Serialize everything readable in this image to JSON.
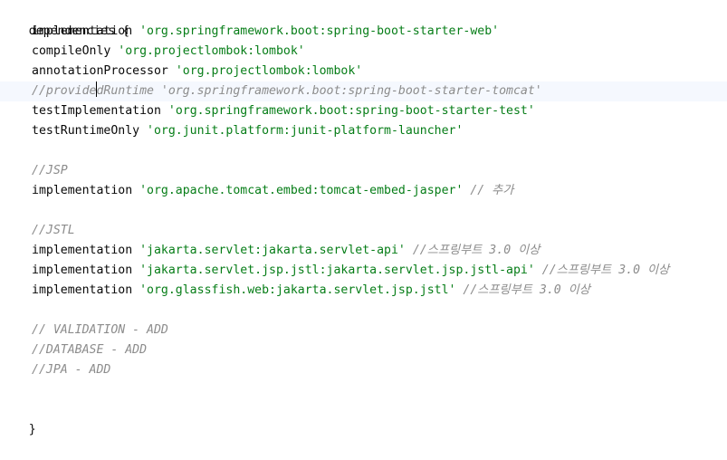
{
  "editor": {
    "block_open": "dependencies {",
    "block_close": "}",
    "lines": [
      {
        "method": "implementation",
        "value": "'org.springframework.boot:spring-boot-starter-web'"
      },
      {
        "method": "compileOnly",
        "value": "'org.projectlombok:lombok'"
      },
      {
        "method": "annotationProcessor",
        "value": "'org.projectlombok:lombok'"
      },
      {
        "comment_before_caret": "//provide",
        "comment_after_caret": "dRuntime 'org.springframework.boot:spring-boot-starter-tomcat'"
      },
      {
        "method": "testImplementation",
        "value": "'org.springframework.boot:spring-boot-starter-test'"
      },
      {
        "method": "testRuntimeOnly",
        "value": "'org.junit.platform:junit-platform-launcher'"
      },
      {
        "comment": "//JSP"
      },
      {
        "method": "implementation",
        "value": "'org.apache.tomcat.embed:tomcat-embed-jasper'",
        "comment": "// 추가"
      },
      {
        "comment": "//JSTL"
      },
      {
        "method": "implementation",
        "value": "'jakarta.servlet:jakarta.servlet-api'",
        "comment": "//스프링부트 3.0 이상"
      },
      {
        "method": "implementation",
        "value": "'jakarta.servlet.jsp.jstl:jakarta.servlet.jsp.jstl-api'",
        "comment": "//스프링부트 3.0 이상"
      },
      {
        "method": "implementation",
        "value": "'org.glassfish.web:jakarta.servlet.jsp.jstl'",
        "comment": "//스프링부트 3.0 이상"
      },
      {
        "comment": "// VALIDATION - ADD"
      },
      {
        "comment": "//DATABASE - ADD"
      },
      {
        "comment": "//JPA - ADD"
      }
    ]
  }
}
